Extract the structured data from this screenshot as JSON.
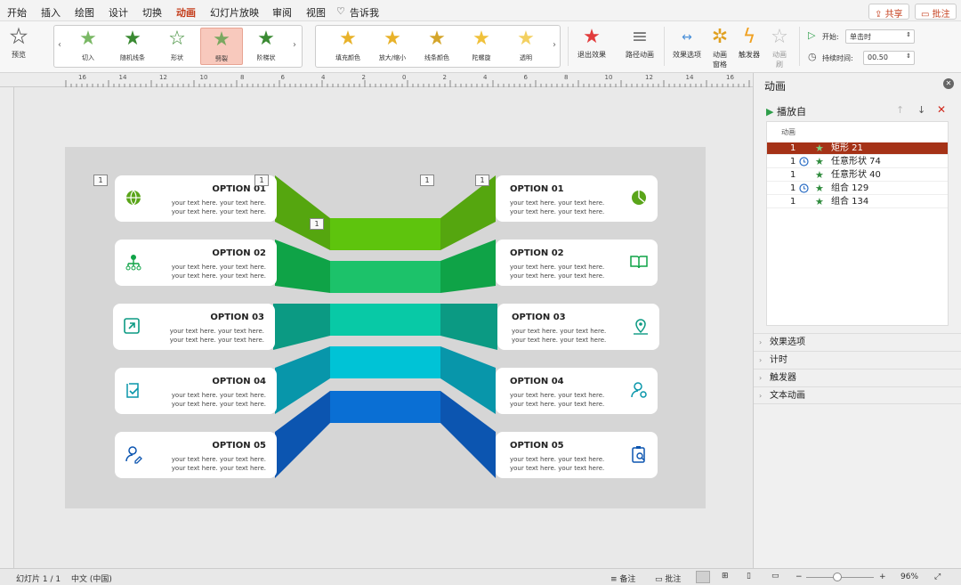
{
  "menu": {
    "items": [
      "开始",
      "插入",
      "绘图",
      "设计",
      "切换",
      "动画",
      "幻灯片放映",
      "审阅",
      "视图"
    ],
    "active": "动画",
    "tell_me": "告诉我",
    "share": "共享",
    "comment": "批注"
  },
  "ribbon": {
    "preview": "预览",
    "entrance_effects": [
      "切入",
      "随机线条",
      "形状",
      "劈裂",
      "阶梯状"
    ],
    "selected_effect": "劈裂",
    "emphasis_effects": [
      "填充颜色",
      "放大/缩小",
      "线条颜色",
      "陀螺旋",
      "透明"
    ],
    "exit": "退出效果",
    "path": "路径动画",
    "effect_options": "效果选项",
    "anim_pane": "动画窗格",
    "trigger": "触发器",
    "anim_brush": "动画刷",
    "start_label": "开始:",
    "start_value": "单击时",
    "duration_label": "持续时间:",
    "duration_value": "00.50"
  },
  "ruler": {
    "ticks": [
      "16",
      "14",
      "12",
      "10",
      "8",
      "6",
      "4",
      "2",
      "0",
      "2",
      "4",
      "6",
      "8",
      "10",
      "12",
      "14",
      "16"
    ]
  },
  "slide": {
    "left_options": [
      {
        "title": "OPTION 01",
        "line1": "your text here. your text here.",
        "line2": "your text here. your text here.",
        "icon": "globe-icon"
      },
      {
        "title": "OPTION 02",
        "line1": "your text here. your text here.",
        "line2": "your text here. your text here.",
        "icon": "org-chart-icon"
      },
      {
        "title": "OPTION 03",
        "line1": "your text here. your text here.",
        "line2": "your text here. your text here.",
        "icon": "export-square-icon"
      },
      {
        "title": "OPTION 04",
        "line1": "your text here. your text here.",
        "line2": "your text here. your text here.",
        "icon": "checklist-icon"
      },
      {
        "title": "OPTION 05",
        "line1": "your text here. your text here.",
        "line2": "your text here. your text here.",
        "icon": "user-edit-icon"
      }
    ],
    "right_options": [
      {
        "title": "OPTION 01",
        "line1": "your text here. your text here.",
        "line2": "your text here. your text here.",
        "icon": "pie-chart-icon"
      },
      {
        "title": "OPTION 02",
        "line1": "your text here. your text here.",
        "line2": "your text here. your text here.",
        "icon": "open-book-icon"
      },
      {
        "title": "OPTION 03",
        "line1": "your text here. your text here.",
        "line2": "your text here. your text here.",
        "icon": "map-pin-icon"
      },
      {
        "title": "OPTION 04",
        "line1": "your text here. your text here.",
        "line2": "your text here. your text here.",
        "icon": "user-settings-icon"
      },
      {
        "title": "OPTION 05",
        "line1": "your text here. your text here.",
        "line2": "your text here. your text here.",
        "icon": "clipboard-search-icon"
      }
    ],
    "badges": [
      "1",
      "1",
      "1",
      "1",
      "1"
    ],
    "band_colors": [
      "#55a60f",
      "#0fa347",
      "#0b9a83",
      "#0896aa",
      "#0c55b0"
    ],
    "band_center_colors": [
      "#5ec40d",
      "#1cc26a",
      "#08c9a6",
      "#00c3d6",
      "#0a6fd4"
    ]
  },
  "pane": {
    "title": "动画",
    "play_from": "播放自",
    "list_header": "动画",
    "items": [
      {
        "num": "1",
        "name": "矩形 21",
        "clock": false,
        "selected": true
      },
      {
        "num": "1",
        "name": "任意形状 74",
        "clock": true,
        "selected": false
      },
      {
        "num": "1",
        "name": "任意形状 40",
        "clock": false,
        "selected": false
      },
      {
        "num": "1",
        "name": "组合 129",
        "clock": true,
        "selected": false
      },
      {
        "num": "1",
        "name": "组合 134",
        "clock": false,
        "selected": false
      }
    ],
    "sections": [
      "效果选项",
      "计时",
      "触发器",
      "文本动画"
    ]
  },
  "status": {
    "slide": "幻灯片 1 / 1",
    "lang": "中文 (中国)",
    "notes": "备注",
    "comments": "批注",
    "zoom": "96%"
  },
  "colors": {
    "accent": "#c43e1c",
    "selected_row": "#a53217"
  }
}
